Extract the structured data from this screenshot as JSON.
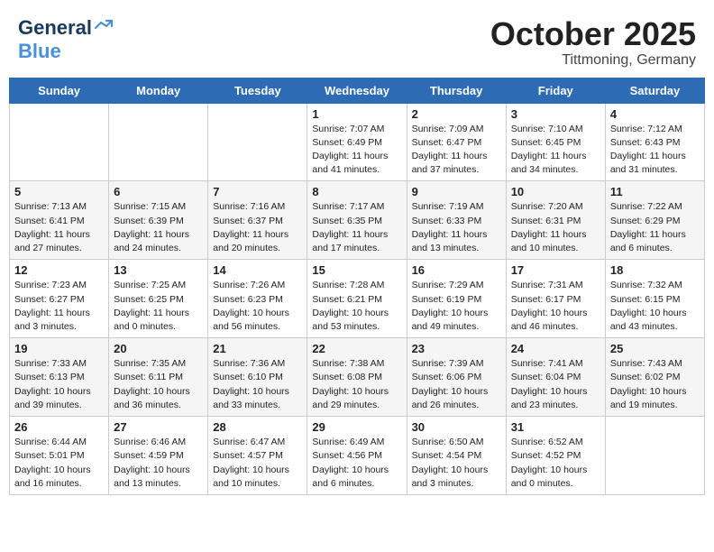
{
  "header": {
    "logo_line1": "General",
    "logo_line2": "Blue",
    "month": "October 2025",
    "location": "Tittmoning, Germany"
  },
  "weekdays": [
    "Sunday",
    "Monday",
    "Tuesday",
    "Wednesday",
    "Thursday",
    "Friday",
    "Saturday"
  ],
  "weeks": [
    [
      {
        "day": "",
        "info": ""
      },
      {
        "day": "",
        "info": ""
      },
      {
        "day": "",
        "info": ""
      },
      {
        "day": "1",
        "info": "Sunrise: 7:07 AM\nSunset: 6:49 PM\nDaylight: 11 hours\nand 41 minutes."
      },
      {
        "day": "2",
        "info": "Sunrise: 7:09 AM\nSunset: 6:47 PM\nDaylight: 11 hours\nand 37 minutes."
      },
      {
        "day": "3",
        "info": "Sunrise: 7:10 AM\nSunset: 6:45 PM\nDaylight: 11 hours\nand 34 minutes."
      },
      {
        "day": "4",
        "info": "Sunrise: 7:12 AM\nSunset: 6:43 PM\nDaylight: 11 hours\nand 31 minutes."
      }
    ],
    [
      {
        "day": "5",
        "info": "Sunrise: 7:13 AM\nSunset: 6:41 PM\nDaylight: 11 hours\nand 27 minutes."
      },
      {
        "day": "6",
        "info": "Sunrise: 7:15 AM\nSunset: 6:39 PM\nDaylight: 11 hours\nand 24 minutes."
      },
      {
        "day": "7",
        "info": "Sunrise: 7:16 AM\nSunset: 6:37 PM\nDaylight: 11 hours\nand 20 minutes."
      },
      {
        "day": "8",
        "info": "Sunrise: 7:17 AM\nSunset: 6:35 PM\nDaylight: 11 hours\nand 17 minutes."
      },
      {
        "day": "9",
        "info": "Sunrise: 7:19 AM\nSunset: 6:33 PM\nDaylight: 11 hours\nand 13 minutes."
      },
      {
        "day": "10",
        "info": "Sunrise: 7:20 AM\nSunset: 6:31 PM\nDaylight: 11 hours\nand 10 minutes."
      },
      {
        "day": "11",
        "info": "Sunrise: 7:22 AM\nSunset: 6:29 PM\nDaylight: 11 hours\nand 6 minutes."
      }
    ],
    [
      {
        "day": "12",
        "info": "Sunrise: 7:23 AM\nSunset: 6:27 PM\nDaylight: 11 hours\nand 3 minutes."
      },
      {
        "day": "13",
        "info": "Sunrise: 7:25 AM\nSunset: 6:25 PM\nDaylight: 11 hours\nand 0 minutes."
      },
      {
        "day": "14",
        "info": "Sunrise: 7:26 AM\nSunset: 6:23 PM\nDaylight: 10 hours\nand 56 minutes."
      },
      {
        "day": "15",
        "info": "Sunrise: 7:28 AM\nSunset: 6:21 PM\nDaylight: 10 hours\nand 53 minutes."
      },
      {
        "day": "16",
        "info": "Sunrise: 7:29 AM\nSunset: 6:19 PM\nDaylight: 10 hours\nand 49 minutes."
      },
      {
        "day": "17",
        "info": "Sunrise: 7:31 AM\nSunset: 6:17 PM\nDaylight: 10 hours\nand 46 minutes."
      },
      {
        "day": "18",
        "info": "Sunrise: 7:32 AM\nSunset: 6:15 PM\nDaylight: 10 hours\nand 43 minutes."
      }
    ],
    [
      {
        "day": "19",
        "info": "Sunrise: 7:33 AM\nSunset: 6:13 PM\nDaylight: 10 hours\nand 39 minutes."
      },
      {
        "day": "20",
        "info": "Sunrise: 7:35 AM\nSunset: 6:11 PM\nDaylight: 10 hours\nand 36 minutes."
      },
      {
        "day": "21",
        "info": "Sunrise: 7:36 AM\nSunset: 6:10 PM\nDaylight: 10 hours\nand 33 minutes."
      },
      {
        "day": "22",
        "info": "Sunrise: 7:38 AM\nSunset: 6:08 PM\nDaylight: 10 hours\nand 29 minutes."
      },
      {
        "day": "23",
        "info": "Sunrise: 7:39 AM\nSunset: 6:06 PM\nDaylight: 10 hours\nand 26 minutes."
      },
      {
        "day": "24",
        "info": "Sunrise: 7:41 AM\nSunset: 6:04 PM\nDaylight: 10 hours\nand 23 minutes."
      },
      {
        "day": "25",
        "info": "Sunrise: 7:43 AM\nSunset: 6:02 PM\nDaylight: 10 hours\nand 19 minutes."
      }
    ],
    [
      {
        "day": "26",
        "info": "Sunrise: 6:44 AM\nSunset: 5:01 PM\nDaylight: 10 hours\nand 16 minutes."
      },
      {
        "day": "27",
        "info": "Sunrise: 6:46 AM\nSunset: 4:59 PM\nDaylight: 10 hours\nand 13 minutes."
      },
      {
        "day": "28",
        "info": "Sunrise: 6:47 AM\nSunset: 4:57 PM\nDaylight: 10 hours\nand 10 minutes."
      },
      {
        "day": "29",
        "info": "Sunrise: 6:49 AM\nSunset: 4:56 PM\nDaylight: 10 hours\nand 6 minutes."
      },
      {
        "day": "30",
        "info": "Sunrise: 6:50 AM\nSunset: 4:54 PM\nDaylight: 10 hours\nand 3 minutes."
      },
      {
        "day": "31",
        "info": "Sunrise: 6:52 AM\nSunset: 4:52 PM\nDaylight: 10 hours\nand 0 minutes."
      },
      {
        "day": "",
        "info": ""
      }
    ]
  ]
}
